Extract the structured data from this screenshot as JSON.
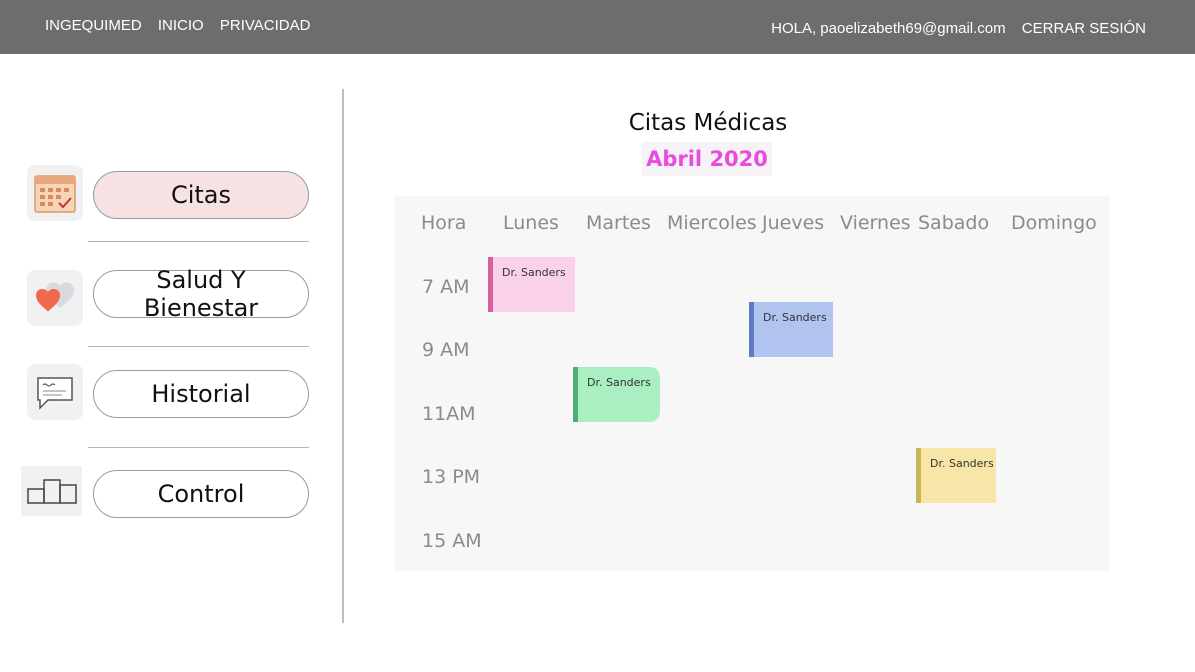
{
  "topbar": {
    "brand": "INGEQUIMED",
    "nav": [
      "INICIO",
      "PRIVACIDAD"
    ],
    "greeting": "HOLA, paoelizabeth69@gmail.com",
    "logout": "CERRAR SESIÓN"
  },
  "sidebar": {
    "items": [
      {
        "label": "Citas",
        "icon": "calendar-icon",
        "active": true
      },
      {
        "label": "Salud Y Bienestar",
        "icon": "heart-icon",
        "active": false
      },
      {
        "label": "Historial",
        "icon": "chat-bubble-icon",
        "active": false
      },
      {
        "label": "Control",
        "icon": "podium-icon",
        "active": false
      }
    ]
  },
  "main": {
    "title": "Citas Médicas",
    "month": "Abril 2020",
    "calendar": {
      "hour_header": "Hora",
      "days": [
        "Lunes",
        "Martes",
        "Miercoles",
        "Jueves",
        "Viernes",
        "Sabado",
        "Domingo"
      ],
      "hours": [
        "7 AM",
        "9 AM",
        "11AM",
        "13 PM",
        "15 AM"
      ],
      "appointments": [
        {
          "label": "Dr. Sanders",
          "day": "Lunes",
          "color": "#f9d1e8",
          "accent": "#d9609c"
        },
        {
          "label": "Dr. Sanders",
          "day": "Jueves",
          "color": "#b1c3ef",
          "accent": "#5f7ac9"
        },
        {
          "label": "Dr. Sanders",
          "day": "Martes",
          "color": "#a9efc2",
          "accent": "#4fae74"
        },
        {
          "label": "Dr. Sanders",
          "day": "Sabado",
          "color": "#f8e6a8",
          "accent": "#c9b45a"
        }
      ]
    }
  }
}
